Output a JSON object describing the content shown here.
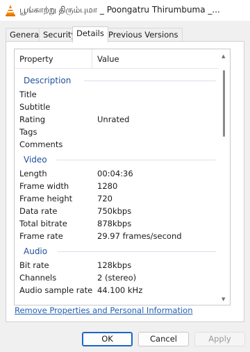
{
  "window": {
    "title": "பூங்காற்று திரும்புமா _ Poongatru Thirumbuma _..."
  },
  "tabs": [
    {
      "label": "General"
    },
    {
      "label": "Security"
    },
    {
      "label": "Details"
    },
    {
      "label": "Previous Versions"
    }
  ],
  "active_tab": "Details",
  "list": {
    "header": {
      "property": "Property",
      "value": "Value"
    },
    "sections": {
      "description": "Description",
      "video": "Video",
      "audio": "Audio"
    },
    "description_rows": [
      {
        "property": "Title",
        "value": ""
      },
      {
        "property": "Subtitle",
        "value": ""
      },
      {
        "property": "Rating",
        "value": "Unrated"
      },
      {
        "property": "Tags",
        "value": ""
      },
      {
        "property": "Comments",
        "value": ""
      }
    ],
    "video_rows": [
      {
        "property": "Length",
        "value": "00:04:36"
      },
      {
        "property": "Frame width",
        "value": "1280"
      },
      {
        "property": "Frame height",
        "value": "720"
      },
      {
        "property": "Data rate",
        "value": "750kbps"
      },
      {
        "property": "Total bitrate",
        "value": "878kbps"
      },
      {
        "property": "Frame rate",
        "value": "29.97 frames/second"
      }
    ],
    "audio_rows": [
      {
        "property": "Bit rate",
        "value": "128kbps"
      },
      {
        "property": "Channels",
        "value": "2 (stereo)"
      },
      {
        "property": "Audio sample rate",
        "value": "44.100 kHz"
      }
    ]
  },
  "link": {
    "label": "Remove Properties and Personal Information"
  },
  "buttons": {
    "ok": "OK",
    "cancel": "Cancel",
    "apply": "Apply"
  },
  "colors": {
    "section_text": "#1f4e9c",
    "link": "#1f5fb4",
    "ok_border": "#1a64c8",
    "vlc_orange": "#f08c00"
  }
}
